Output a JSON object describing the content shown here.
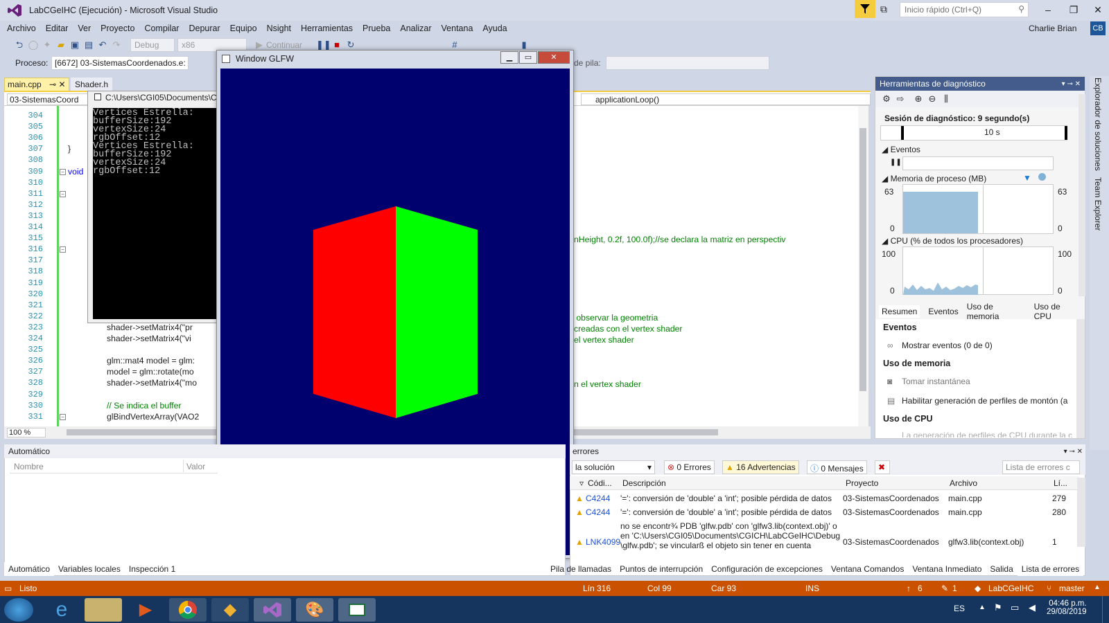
{
  "window": {
    "title": "LabCGeIHC (Ejecución) - Microsoft Visual Studio",
    "quick_launch": "Inicio rápido (Ctrl+Q)",
    "user": "Charlie Brian",
    "avatar": "CB"
  },
  "menu": [
    "Archivo",
    "Editar",
    "Ver",
    "Proyecto",
    "Compilar",
    "Depurar",
    "Equipo",
    "Nsight",
    "Herramientas",
    "Prueba",
    "Analizar",
    "Ventana",
    "Ayuda"
  ],
  "toolbar": {
    "config": "Debug",
    "platform": "x86",
    "continue": "Continuar"
  },
  "process": {
    "label": "Proceso:",
    "value": "[6672] 03-SistemasCoordenados.e:",
    "stack_label": "de pila:"
  },
  "tabs": {
    "active": "main.cpp",
    "other": "Shader.h"
  },
  "nav": {
    "left": "03-SistemasCoord",
    "right": "applicationLoop()"
  },
  "editor": {
    "lines": [
      "304",
      "305",
      "306",
      "307",
      "308",
      "309",
      "310",
      "311",
      "312",
      "313",
      "314",
      "315",
      "316",
      "317",
      "318",
      "319",
      "320",
      "321",
      "322",
      "323",
      "324",
      "325",
      "326",
      "327",
      "328",
      "329",
      "330",
      "331"
    ],
    "zoom": "100 %",
    "code_right": [
      {
        "text": "nHeight, 0.2f, 100.0f);//se declara la matriz en perspectiv",
        "row": 11
      },
      {
        "text": " observar la geometria",
        "row": 18
      },
      {
        "text": "creadas con el vertex shader",
        "row": 19
      },
      {
        "text": "el vertex shader",
        "row": 20
      },
      {
        "text": "n el vertex shader",
        "row": 24
      }
    ],
    "code_left": [
      {
        "row": 3,
        "text": "}"
      },
      {
        "row": 5,
        "text": "void"
      },
      {
        "row": 19,
        "text": "shader->setMatrix4(\"pr"
      },
      {
        "row": 20,
        "text": "shader->setMatrix4(\"vi"
      },
      {
        "row": 22,
        "text": "glm::mat4 model = glm:"
      },
      {
        "row": 23,
        "text": "model = glm::rotate(mo"
      },
      {
        "row": 24,
        "text": "shader->setMatrix4(\"mo"
      },
      {
        "row": 26,
        "text": "// Se indica el buffer"
      },
      {
        "row": 27,
        "text": "glBindVertexArray(VAO2"
      }
    ]
  },
  "console": {
    "title": "C:\\Users\\CGI05\\Documents\\CGICH",
    "output": "Vertices Estrella:\nbufferSize:192\nvertexSize:24\nrgbOffset:12\nVertices Estrella:\nbufferSize:192\nvertexSize:24\nrgbOffset:12"
  },
  "glfw": {
    "title": "Window GLFW",
    "bg": "#00006e",
    "left_face": "#ff0000",
    "right_face": "#00ff00"
  },
  "diagnostics": {
    "title": "Herramientas de diagnóstico",
    "session": "Sesión de diagnóstico: 9 segundo(s)",
    "timeline_label": "10 s",
    "events_label": "Eventos",
    "memory_label": "Memoria de proceso (MB)",
    "memory_max": "63",
    "memory_min": "0",
    "cpu_label": "CPU (% de todos los procesadores)",
    "cpu_max": "100",
    "cpu_min": "0",
    "tabs": [
      "Resumen",
      "Eventos",
      "Uso de memoria",
      "Uso de CPU"
    ],
    "sec_events": "Eventos",
    "show_events": "Mostrar eventos (0 de 0)",
    "sec_memory": "Uso de memoria",
    "snapshot": "Tomar instantánea",
    "heap": "Habilitar generación de perfiles de montón (a",
    "sec_cpu": "Uso de CPU",
    "cpu_note": "La generación de perfiles de CPU durante la c"
  },
  "side": {
    "explorer": "Explorador de soluciones",
    "team": "Team Explorer"
  },
  "autos": {
    "title": "Automático",
    "col_name": "Nombre",
    "col_value": "Valor"
  },
  "errors": {
    "title": "errores",
    "scope": "la solución",
    "errors": "0 Errores",
    "warnings": "16 Advertencias",
    "messages": "0 Mensajes",
    "search": "Lista de errores c",
    "columns": [
      "Códi...",
      "Descripción",
      "Proyecto",
      "Archivo",
      "Lí..."
    ],
    "rows": [
      {
        "code": "C4244",
        "desc": "'=': conversión de 'double' a 'int'; posible pérdida de datos",
        "project": "03-SistemasCoordenados",
        "file": "main.cpp",
        "line": "279"
      },
      {
        "code": "C4244",
        "desc": "'=': conversión de 'double' a 'int'; posible pérdida de datos",
        "project": "03-SistemasCoordenados",
        "file": "main.cpp",
        "line": "280"
      },
      {
        "code": "LNK4099",
        "desc1": "no se encontr¾ PDB 'glfw.pdb' con 'glfw3.lib(context.obj)' o",
        "desc2": "en 'C:\\Users\\CGI05\\Documents\\CGICH\\LabCGeIHC\\Debug",
        "desc3": "\\glfw.pdb'; se vincularß el objeto sin tener en cuenta",
        "project": "03-SistemasCoordenados",
        "file": "glfw3.lib(context.obj)",
        "line": "1"
      }
    ]
  },
  "bottom_tabs_left": [
    "Automático",
    "Variables locales",
    "Inspección 1"
  ],
  "bottom_tabs_right": [
    "Pila de llamadas",
    "Puntos de interrupción",
    "Configuración de excepciones",
    "Ventana Comandos",
    "Ventana Inmediato",
    "Salida",
    "Lista de errores"
  ],
  "status": {
    "ready": "Listo",
    "line": "Lín 316",
    "col": "Col 99",
    "car": "Car 93",
    "ins": "INS",
    "up": "6",
    "edits": "1",
    "repo": "LabCGeIHC",
    "branch": "master"
  },
  "taskbar": {
    "lang": "ES",
    "time": "04:46 p.m.",
    "date": "29/08/2019"
  },
  "colors": {
    "accent": "#ca5100",
    "title": "#d6dbe9"
  }
}
